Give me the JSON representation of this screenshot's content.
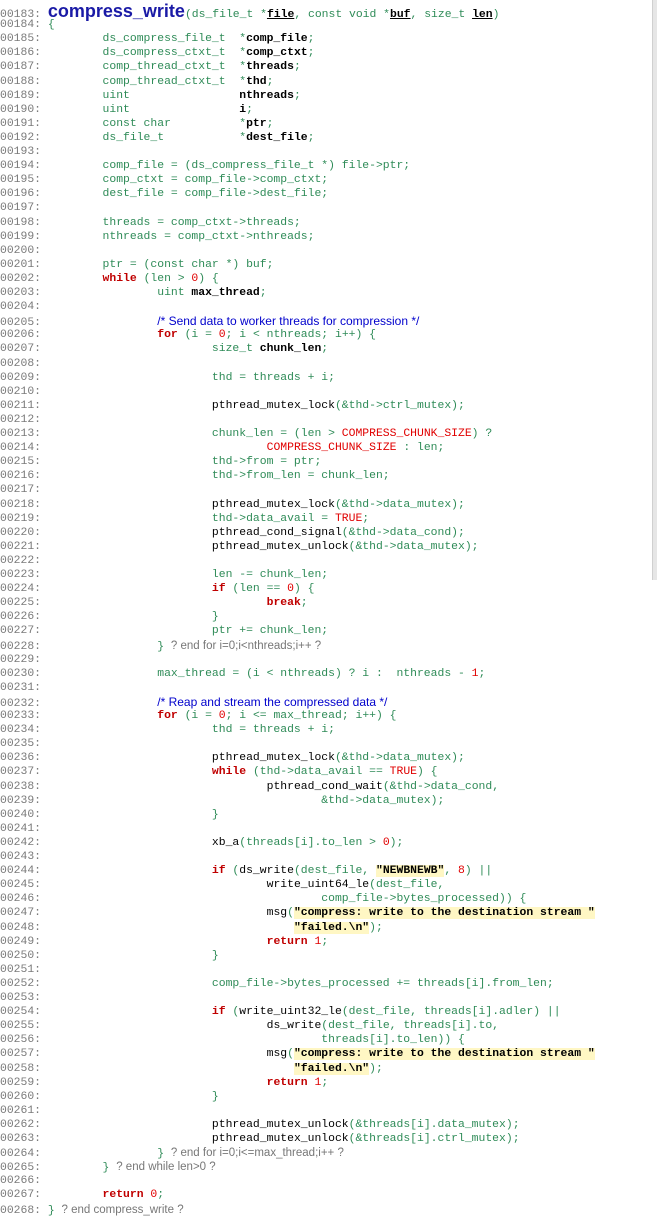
{
  "function_name": "compress_write",
  "lines": [
    {
      "n": "00183:",
      "tokens": [
        [
          "big",
          "compress_write"
        ],
        [
          "c-norm",
          "(ds_file_t *"
        ],
        [
          "c-link",
          "file"
        ],
        [
          "c-norm",
          ", const void *"
        ],
        [
          "c-link",
          "buf"
        ],
        [
          "c-norm",
          ", size_t "
        ],
        [
          "c-link",
          "len"
        ],
        [
          "c-norm",
          ")"
        ]
      ]
    },
    {
      "n": "00184:",
      "tokens": [
        [
          "c-norm",
          "{"
        ]
      ]
    },
    {
      "n": "00185:",
      "tokens": [
        [
          "c-norm",
          "        ds_compress_file_t  *"
        ],
        [
          "c-var",
          "comp_file"
        ],
        [
          "c-norm",
          ";"
        ]
      ]
    },
    {
      "n": "00186:",
      "tokens": [
        [
          "c-norm",
          "        ds_compress_ctxt_t  *"
        ],
        [
          "c-var",
          "comp_ctxt"
        ],
        [
          "c-norm",
          ";"
        ]
      ]
    },
    {
      "n": "00187:",
      "tokens": [
        [
          "c-norm",
          "        comp_thread_ctxt_t  *"
        ],
        [
          "c-var",
          "threads"
        ],
        [
          "c-norm",
          ";"
        ]
      ]
    },
    {
      "n": "00188:",
      "tokens": [
        [
          "c-norm",
          "        comp_thread_ctxt_t  *"
        ],
        [
          "c-var",
          "thd"
        ],
        [
          "c-norm",
          ";"
        ]
      ]
    },
    {
      "n": "00189:",
      "tokens": [
        [
          "c-norm",
          "        uint                "
        ],
        [
          "c-var",
          "nthreads"
        ],
        [
          "c-norm",
          ";"
        ]
      ]
    },
    {
      "n": "00190:",
      "tokens": [
        [
          "c-norm",
          "        uint                "
        ],
        [
          "c-var",
          "i"
        ],
        [
          "c-norm",
          ";"
        ]
      ]
    },
    {
      "n": "00191:",
      "tokens": [
        [
          "c-norm",
          "        const char          *"
        ],
        [
          "c-var",
          "ptr"
        ],
        [
          "c-norm",
          ";"
        ]
      ]
    },
    {
      "n": "00192:",
      "tokens": [
        [
          "c-norm",
          "        ds_file_t           *"
        ],
        [
          "c-var",
          "dest_file"
        ],
        [
          "c-norm",
          ";"
        ]
      ]
    },
    {
      "n": "00193:",
      "tokens": []
    },
    {
      "n": "00194:",
      "tokens": [
        [
          "c-norm",
          "        comp_file = (ds_compress_file_t *) file->ptr;"
        ]
      ]
    },
    {
      "n": "00195:",
      "tokens": [
        [
          "c-norm",
          "        comp_ctxt = comp_file->comp_ctxt;"
        ]
      ]
    },
    {
      "n": "00196:",
      "tokens": [
        [
          "c-norm",
          "        dest_file = comp_file->dest_file;"
        ]
      ]
    },
    {
      "n": "00197:",
      "tokens": []
    },
    {
      "n": "00198:",
      "tokens": [
        [
          "c-norm",
          "        threads = comp_ctxt->threads;"
        ]
      ]
    },
    {
      "n": "00199:",
      "tokens": [
        [
          "c-norm",
          "        nthreads = comp_ctxt->nthreads;"
        ]
      ]
    },
    {
      "n": "00200:",
      "tokens": []
    },
    {
      "n": "00201:",
      "tokens": [
        [
          "c-norm",
          "        ptr = (const char *) buf;"
        ]
      ]
    },
    {
      "n": "00202:",
      "tokens": [
        [
          "c-norm",
          "        "
        ],
        [
          "c-kw",
          "while"
        ],
        [
          "c-norm",
          " (len > "
        ],
        [
          "c-num",
          "0"
        ],
        [
          "c-norm",
          ") {"
        ]
      ]
    },
    {
      "n": "00203:",
      "tokens": [
        [
          "c-norm",
          "                uint "
        ],
        [
          "c-var",
          "max_thread"
        ],
        [
          "c-norm",
          ";"
        ]
      ]
    },
    {
      "n": "00204:",
      "tokens": []
    },
    {
      "n": "00205:",
      "tokens": [
        [
          "c-norm",
          "                "
        ],
        [
          "c-com",
          "/* Send data to worker threads for compression */"
        ]
      ]
    },
    {
      "n": "00206:",
      "tokens": [
        [
          "c-norm",
          "                "
        ],
        [
          "c-kw",
          "for"
        ],
        [
          "c-norm",
          " (i = "
        ],
        [
          "c-num",
          "0"
        ],
        [
          "c-norm",
          "; i < nthreads; i++) {"
        ]
      ]
    },
    {
      "n": "00207:",
      "tokens": [
        [
          "c-norm",
          "                        size_t "
        ],
        [
          "c-var",
          "chunk_len"
        ],
        [
          "c-norm",
          ";"
        ]
      ]
    },
    {
      "n": "00208:",
      "tokens": []
    },
    {
      "n": "00209:",
      "tokens": [
        [
          "c-norm",
          "                        thd = threads + i;"
        ]
      ]
    },
    {
      "n": "00210:",
      "tokens": []
    },
    {
      "n": "00211:",
      "tokens": [
        [
          "c-norm",
          "                        "
        ],
        [
          "c-fn",
          "pthread_mutex_lock"
        ],
        [
          "c-norm",
          "(&thd->ctrl_mutex);"
        ]
      ]
    },
    {
      "n": "00212:",
      "tokens": []
    },
    {
      "n": "00213:",
      "tokens": [
        [
          "c-norm",
          "                        chunk_len = (len > "
        ],
        [
          "c-macro",
          "COMPRESS_CHUNK_SIZE"
        ],
        [
          "c-norm",
          ") ?"
        ]
      ]
    },
    {
      "n": "00214:",
      "tokens": [
        [
          "c-norm",
          "                                "
        ],
        [
          "c-macro",
          "COMPRESS_CHUNK_SIZE"
        ],
        [
          "c-norm",
          " : len;"
        ]
      ]
    },
    {
      "n": "00215:",
      "tokens": [
        [
          "c-norm",
          "                        thd->from = ptr;"
        ]
      ]
    },
    {
      "n": "00216:",
      "tokens": [
        [
          "c-norm",
          "                        thd->from_len = chunk_len;"
        ]
      ]
    },
    {
      "n": "00217:",
      "tokens": []
    },
    {
      "n": "00218:",
      "tokens": [
        [
          "c-norm",
          "                        "
        ],
        [
          "c-fn",
          "pthread_mutex_lock"
        ],
        [
          "c-norm",
          "(&thd->data_mutex);"
        ]
      ]
    },
    {
      "n": "00219:",
      "tokens": [
        [
          "c-norm",
          "                        thd->data_avail = "
        ],
        [
          "c-macro",
          "TRUE"
        ],
        [
          "c-norm",
          ";"
        ]
      ]
    },
    {
      "n": "00220:",
      "tokens": [
        [
          "c-norm",
          "                        "
        ],
        [
          "c-fn",
          "pthread_cond_signal"
        ],
        [
          "c-norm",
          "(&thd->data_cond);"
        ]
      ]
    },
    {
      "n": "00221:",
      "tokens": [
        [
          "c-norm",
          "                        "
        ],
        [
          "c-fn",
          "pthread_mutex_unlock"
        ],
        [
          "c-norm",
          "(&thd->data_mutex);"
        ]
      ]
    },
    {
      "n": "00222:",
      "tokens": []
    },
    {
      "n": "00223:",
      "tokens": [
        [
          "c-norm",
          "                        len -= chunk_len;"
        ]
      ]
    },
    {
      "n": "00224:",
      "tokens": [
        [
          "c-norm",
          "                        "
        ],
        [
          "c-kw",
          "if"
        ],
        [
          "c-norm",
          " (len == "
        ],
        [
          "c-num",
          "0"
        ],
        [
          "c-norm",
          ") {"
        ]
      ]
    },
    {
      "n": "00225:",
      "tokens": [
        [
          "c-norm",
          "                                "
        ],
        [
          "c-kw",
          "break"
        ],
        [
          "c-norm",
          ";"
        ]
      ]
    },
    {
      "n": "00226:",
      "tokens": [
        [
          "c-norm",
          "                        }"
        ]
      ]
    },
    {
      "n": "00227:",
      "tokens": [
        [
          "c-norm",
          "                        ptr += chunk_len;"
        ]
      ]
    },
    {
      "n": "00228:",
      "tokens": [
        [
          "c-norm",
          "                } "
        ],
        [
          "c-endc",
          "? end for i=0;i<nthreads;i++ ?"
        ]
      ]
    },
    {
      "n": "00229:",
      "tokens": []
    },
    {
      "n": "00230:",
      "tokens": [
        [
          "c-norm",
          "                max_thread = (i < nthreads) ? i :  nthreads - "
        ],
        [
          "c-num",
          "1"
        ],
        [
          "c-norm",
          ";"
        ]
      ]
    },
    {
      "n": "00231:",
      "tokens": []
    },
    {
      "n": "00232:",
      "tokens": [
        [
          "c-norm",
          "                "
        ],
        [
          "c-com",
          "/* Reap and stream the compressed data */"
        ]
      ]
    },
    {
      "n": "00233:",
      "tokens": [
        [
          "c-norm",
          "                "
        ],
        [
          "c-kw",
          "for"
        ],
        [
          "c-norm",
          " (i = "
        ],
        [
          "c-num",
          "0"
        ],
        [
          "c-norm",
          "; i <= max_thread; i++) {"
        ]
      ]
    },
    {
      "n": "00234:",
      "tokens": [
        [
          "c-norm",
          "                        thd = threads + i;"
        ]
      ]
    },
    {
      "n": "00235:",
      "tokens": []
    },
    {
      "n": "00236:",
      "tokens": [
        [
          "c-norm",
          "                        "
        ],
        [
          "c-fn",
          "pthread_mutex_lock"
        ],
        [
          "c-norm",
          "(&thd->data_mutex);"
        ]
      ]
    },
    {
      "n": "00237:",
      "tokens": [
        [
          "c-norm",
          "                        "
        ],
        [
          "c-kw",
          "while"
        ],
        [
          "c-norm",
          " (thd->data_avail == "
        ],
        [
          "c-macro",
          "TRUE"
        ],
        [
          "c-norm",
          ") {"
        ]
      ]
    },
    {
      "n": "00238:",
      "tokens": [
        [
          "c-norm",
          "                                "
        ],
        [
          "c-fn",
          "pthread_cond_wait"
        ],
        [
          "c-norm",
          "(&thd->data_cond,"
        ]
      ]
    },
    {
      "n": "00239:",
      "tokens": [
        [
          "c-norm",
          "                                        &thd->data_mutex);"
        ]
      ]
    },
    {
      "n": "00240:",
      "tokens": [
        [
          "c-norm",
          "                        }"
        ]
      ]
    },
    {
      "n": "00241:",
      "tokens": []
    },
    {
      "n": "00242:",
      "tokens": [
        [
          "c-norm",
          "                        "
        ],
        [
          "c-fn",
          "xb_a"
        ],
        [
          "c-norm",
          "(threads[i].to_len > "
        ],
        [
          "c-num",
          "0"
        ],
        [
          "c-norm",
          ");"
        ]
      ]
    },
    {
      "n": "00243:",
      "tokens": []
    },
    {
      "n": "00244:",
      "tokens": [
        [
          "c-norm",
          "                        "
        ],
        [
          "c-kw",
          "if"
        ],
        [
          "c-norm",
          " ("
        ],
        [
          "c-fn",
          "ds_write"
        ],
        [
          "c-norm",
          "(dest_file, "
        ],
        [
          "c-str",
          "\"NEWBNEWB\""
        ],
        [
          "c-norm",
          ", "
        ],
        [
          "c-num",
          "8"
        ],
        [
          "c-norm",
          ") ||"
        ]
      ]
    },
    {
      "n": "00245:",
      "tokens": [
        [
          "c-norm",
          "                                "
        ],
        [
          "c-fn",
          "write_uint64_le"
        ],
        [
          "c-norm",
          "(dest_file,"
        ]
      ]
    },
    {
      "n": "00246:",
      "tokens": [
        [
          "c-norm",
          "                                        comp_file->bytes_processed)) {"
        ]
      ]
    },
    {
      "n": "00247:",
      "tokens": [
        [
          "c-norm",
          "                                "
        ],
        [
          "c-fn",
          "msg"
        ],
        [
          "c-norm",
          "("
        ],
        [
          "c-str",
          "\"compress: write to the destination stream \""
        ]
      ]
    },
    {
      "n": "00248:",
      "tokens": [
        [
          "c-norm",
          "                                    "
        ],
        [
          "c-str",
          "\"failed.\\n\""
        ],
        [
          "c-norm",
          ");"
        ]
      ]
    },
    {
      "n": "00249:",
      "tokens": [
        [
          "c-norm",
          "                                "
        ],
        [
          "c-kw",
          "return"
        ],
        [
          "c-norm",
          " "
        ],
        [
          "c-num",
          "1"
        ],
        [
          "c-norm",
          ";"
        ]
      ]
    },
    {
      "n": "00250:",
      "tokens": [
        [
          "c-norm",
          "                        }"
        ]
      ]
    },
    {
      "n": "00251:",
      "tokens": []
    },
    {
      "n": "00252:",
      "tokens": [
        [
          "c-norm",
          "                        comp_file->bytes_processed += threads[i].from_len;"
        ]
      ]
    },
    {
      "n": "00253:",
      "tokens": []
    },
    {
      "n": "00254:",
      "tokens": [
        [
          "c-norm",
          "                        "
        ],
        [
          "c-kw",
          "if"
        ],
        [
          "c-norm",
          " ("
        ],
        [
          "c-fn",
          "write_uint32_le"
        ],
        [
          "c-norm",
          "(dest_file, threads[i].adler) ||"
        ]
      ]
    },
    {
      "n": "00255:",
      "tokens": [
        [
          "c-norm",
          "                                "
        ],
        [
          "c-fn",
          "ds_write"
        ],
        [
          "c-norm",
          "(dest_file, threads[i].to,"
        ]
      ]
    },
    {
      "n": "00256:",
      "tokens": [
        [
          "c-norm",
          "                                        threads[i].to_len)) {"
        ]
      ]
    },
    {
      "n": "00257:",
      "tokens": [
        [
          "c-norm",
          "                                "
        ],
        [
          "c-fn",
          "msg"
        ],
        [
          "c-norm",
          "("
        ],
        [
          "c-str",
          "\"compress: write to the destination stream \""
        ]
      ]
    },
    {
      "n": "00258:",
      "tokens": [
        [
          "c-norm",
          "                                    "
        ],
        [
          "c-str",
          "\"failed.\\n\""
        ],
        [
          "c-norm",
          ");"
        ]
      ]
    },
    {
      "n": "00259:",
      "tokens": [
        [
          "c-norm",
          "                                "
        ],
        [
          "c-kw",
          "return"
        ],
        [
          "c-norm",
          " "
        ],
        [
          "c-num",
          "1"
        ],
        [
          "c-norm",
          ";"
        ]
      ]
    },
    {
      "n": "00260:",
      "tokens": [
        [
          "c-norm",
          "                        }"
        ]
      ]
    },
    {
      "n": "00261:",
      "tokens": []
    },
    {
      "n": "00262:",
      "tokens": [
        [
          "c-norm",
          "                        "
        ],
        [
          "c-fn",
          "pthread_mutex_unlock"
        ],
        [
          "c-norm",
          "(&threads[i].data_mutex);"
        ]
      ]
    },
    {
      "n": "00263:",
      "tokens": [
        [
          "c-norm",
          "                        "
        ],
        [
          "c-fn",
          "pthread_mutex_unlock"
        ],
        [
          "c-norm",
          "(&threads[i].ctrl_mutex);"
        ]
      ]
    },
    {
      "n": "00264:",
      "tokens": [
        [
          "c-norm",
          "                } "
        ],
        [
          "c-endc",
          "? end for i=0;i<=max_thread;i++ ?"
        ]
      ]
    },
    {
      "n": "00265:",
      "tokens": [
        [
          "c-norm",
          "        } "
        ],
        [
          "c-endc",
          "? end while len>0 ?"
        ]
      ]
    },
    {
      "n": "00266:",
      "tokens": []
    },
    {
      "n": "00267:",
      "tokens": [
        [
          "c-norm",
          "        "
        ],
        [
          "c-kw",
          "return"
        ],
        [
          "c-norm",
          " "
        ],
        [
          "c-num",
          "0"
        ],
        [
          "c-norm",
          ";"
        ]
      ]
    },
    {
      "n": "00268:",
      "tokens": [
        [
          "c-norm",
          "} "
        ],
        [
          "c-endc",
          "? end compress_write ?"
        ]
      ]
    }
  ]
}
